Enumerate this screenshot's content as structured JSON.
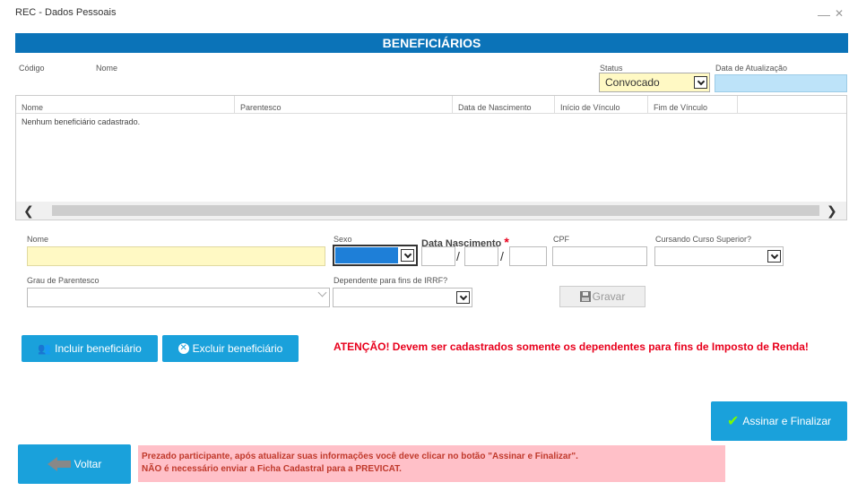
{
  "window": {
    "title": "REC - Dados Pessoais",
    "minimize": "—",
    "close": "✕"
  },
  "header": {
    "title": "BENEFICIÁRIOS"
  },
  "top_fields": {
    "codigo_label": "Código",
    "nome_label": "Nome",
    "status_label": "Status",
    "status_value": "Convocado",
    "data_atualizacao_label": "Data de Atualização"
  },
  "grid": {
    "columns": [
      "Nome",
      "Parentesco",
      "Data de Nascimento",
      "Início de Vínculo",
      "Fim de Vínculo"
    ],
    "empty_message": "Nenhum beneficiário cadastrado."
  },
  "form": {
    "nome_label": "Nome",
    "sexo_label": "Sexo",
    "data_nasc_label": "Data Nascimento",
    "required_mark": "*",
    "date_sep": "/",
    "cpf_label": "CPF",
    "cursando_label": "Cursando Curso Superior?",
    "grau_label": "Grau de Parentesco",
    "dependente_label": "Dependente para fins de IRRF?",
    "gravar_label": "Gravar"
  },
  "actions": {
    "incluir_label": "Incluir beneficiário",
    "excluir_label": "Excluir beneficiário",
    "attention": "ATENÇÃO! Devem ser cadastrados somente os dependentes para fins de Imposto de Renda!",
    "assinar_label": "Assinar e Finalizar",
    "voltar_label": "Voltar"
  },
  "note": {
    "line1": "Prezado participante, após atualizar suas informações você deve clicar no botão \"Assinar e Finalizar\".",
    "line2": "NÃO é necessário enviar a Ficha Cadastral para a PREVICAT."
  },
  "colors": {
    "header": "#0B73B8",
    "button": "#1AA1DB",
    "attention": "#E8001C",
    "note_bg": "#FFC0C8",
    "highlight_yellow": "#FFF9C4"
  }
}
